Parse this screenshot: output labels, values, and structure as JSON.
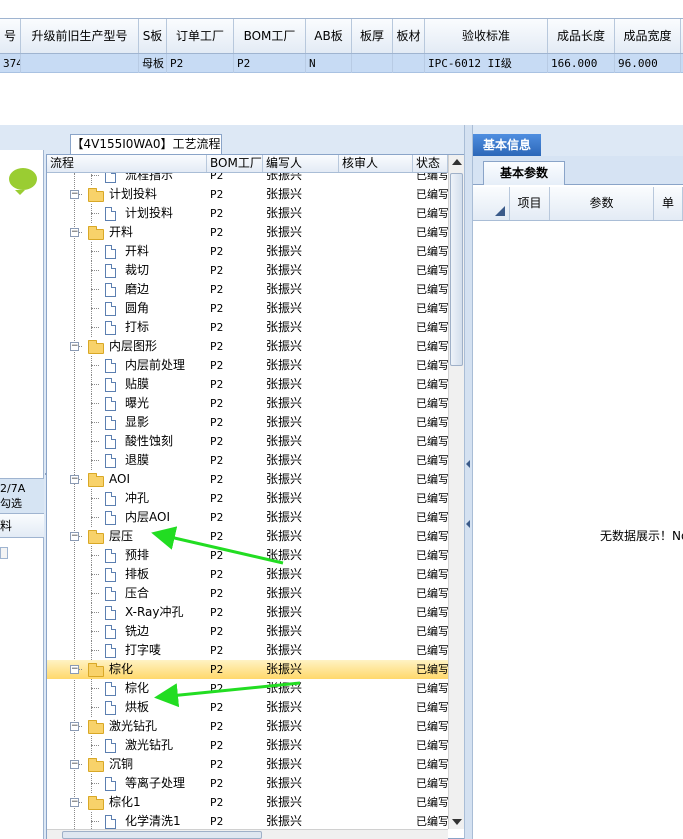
{
  "top_grid": {
    "columns": [
      "号",
      "升级前旧生产型号",
      "S板",
      "订单工厂",
      "BOM工厂",
      "AB板",
      "板厚",
      "板材",
      "验收标准",
      "成品长度",
      "成品宽度"
    ],
    "row": [
      "374",
      "",
      "母板",
      "P2",
      "P2",
      "N",
      "",
      "",
      "IPC-6012 II级",
      "166.000",
      "96.000"
    ]
  },
  "left_panel": {
    "tab_text": "2/7A\n勾选",
    "header": "料"
  },
  "process_tab": "【4V155I0WA0】工艺流程",
  "tree": {
    "columns": [
      "流程",
      "BOM工厂",
      "编写人",
      "核审人",
      "状态"
    ],
    "rows": [
      {
        "level": 2,
        "name": "流程指示",
        "bom": "P2",
        "writer": "张振兴",
        "reviewer": "",
        "status": "已编写"
      },
      {
        "level": 1,
        "name": "计划投料",
        "bom": "P2",
        "writer": "张振兴",
        "reviewer": "",
        "status": "已编写"
      },
      {
        "level": 2,
        "name": "计划投料",
        "bom": "P2",
        "writer": "张振兴",
        "reviewer": "",
        "status": "已编写"
      },
      {
        "level": 1,
        "name": "开料",
        "bom": "P2",
        "writer": "张振兴",
        "reviewer": "",
        "status": "已编写"
      },
      {
        "level": 2,
        "name": "开料",
        "bom": "P2",
        "writer": "张振兴",
        "reviewer": "",
        "status": "已编写"
      },
      {
        "level": 2,
        "name": "裁切",
        "bom": "P2",
        "writer": "张振兴",
        "reviewer": "",
        "status": "已编写"
      },
      {
        "level": 2,
        "name": "磨边",
        "bom": "P2",
        "writer": "张振兴",
        "reviewer": "",
        "status": "已编写"
      },
      {
        "level": 2,
        "name": "圆角",
        "bom": "P2",
        "writer": "张振兴",
        "reviewer": "",
        "status": "已编写"
      },
      {
        "level": 2,
        "name": "打标",
        "bom": "P2",
        "writer": "张振兴",
        "reviewer": "",
        "status": "已编写"
      },
      {
        "level": 1,
        "name": "内层图形",
        "bom": "P2",
        "writer": "张振兴",
        "reviewer": "",
        "status": "已编写"
      },
      {
        "level": 2,
        "name": "内层前处理",
        "bom": "P2",
        "writer": "张振兴",
        "reviewer": "",
        "status": "已编写"
      },
      {
        "level": 2,
        "name": "贴膜",
        "bom": "P2",
        "writer": "张振兴",
        "reviewer": "",
        "status": "已编写"
      },
      {
        "level": 2,
        "name": "曝光",
        "bom": "P2",
        "writer": "张振兴",
        "reviewer": "",
        "status": "已编写"
      },
      {
        "level": 2,
        "name": "显影",
        "bom": "P2",
        "writer": "张振兴",
        "reviewer": "",
        "status": "已编写"
      },
      {
        "level": 2,
        "name": "酸性蚀刻",
        "bom": "P2",
        "writer": "张振兴",
        "reviewer": "",
        "status": "已编写"
      },
      {
        "level": 2,
        "name": "退膜",
        "bom": "P2",
        "writer": "张振兴",
        "reviewer": "",
        "status": "已编写"
      },
      {
        "level": 1,
        "name": "AOI",
        "bom": "P2",
        "writer": "张振兴",
        "reviewer": "",
        "status": "已编写"
      },
      {
        "level": 2,
        "name": "冲孔",
        "bom": "P2",
        "writer": "张振兴",
        "reviewer": "",
        "status": "已编写"
      },
      {
        "level": 2,
        "name": "内层AOI",
        "bom": "P2",
        "writer": "张振兴",
        "reviewer": "",
        "status": "已编写"
      },
      {
        "level": 1,
        "name": "层压",
        "bom": "P2",
        "writer": "张振兴",
        "reviewer": "",
        "status": "已编写"
      },
      {
        "level": 2,
        "name": "预排",
        "bom": "P2",
        "writer": "张振兴",
        "reviewer": "",
        "status": "已编写"
      },
      {
        "level": 2,
        "name": "排板",
        "bom": "P2",
        "writer": "张振兴",
        "reviewer": "",
        "status": "已编写"
      },
      {
        "level": 2,
        "name": "压合",
        "bom": "P2",
        "writer": "张振兴",
        "reviewer": "",
        "status": "已编写"
      },
      {
        "level": 2,
        "name": "X-Ray冲孔",
        "bom": "P2",
        "writer": "张振兴",
        "reviewer": "",
        "status": "已编写"
      },
      {
        "level": 2,
        "name": "铣边",
        "bom": "P2",
        "writer": "张振兴",
        "reviewer": "",
        "status": "已编写"
      },
      {
        "level": 2,
        "name": "打字唛",
        "bom": "P2",
        "writer": "张振兴",
        "reviewer": "",
        "status": "已编写"
      },
      {
        "level": 1,
        "name": "棕化",
        "bom": "P2",
        "writer": "张振兴",
        "reviewer": "",
        "status": "已编写",
        "selected": true
      },
      {
        "level": 2,
        "name": "棕化",
        "bom": "P2",
        "writer": "张振兴",
        "reviewer": "",
        "status": "已编写"
      },
      {
        "level": 2,
        "name": "烘板",
        "bom": "P2",
        "writer": "张振兴",
        "reviewer": "",
        "status": "已编写"
      },
      {
        "level": 1,
        "name": "激光钻孔",
        "bom": "P2",
        "writer": "张振兴",
        "reviewer": "",
        "status": "已编写"
      },
      {
        "level": 2,
        "name": "激光钻孔",
        "bom": "P2",
        "writer": "张振兴",
        "reviewer": "",
        "status": "已编写"
      },
      {
        "level": 1,
        "name": "沉铜",
        "bom": "P2",
        "writer": "张振兴",
        "reviewer": "",
        "status": "已编写"
      },
      {
        "level": 2,
        "name": "等离子处理",
        "bom": "P2",
        "writer": "张振兴",
        "reviewer": "",
        "status": "已编写"
      },
      {
        "level": 1,
        "name": "棕化1",
        "bom": "P2",
        "writer": "张振兴",
        "reviewer": "",
        "status": "已编写"
      },
      {
        "level": 2,
        "name": "化学清洗1",
        "bom": "P2",
        "writer": "张振兴",
        "reviewer": "",
        "status": "已编写"
      }
    ]
  },
  "right_panel": {
    "top_tab": "基本信息",
    "inner_tab": "基本参数",
    "columns": [
      "",
      "项目",
      "参数",
      "单"
    ],
    "empty_text": "无数据展示！No"
  },
  "colors": {
    "selected_row": "#ffd86b",
    "accent_tab": "#2c67b8",
    "annotation_arrow": "#22dd22"
  }
}
